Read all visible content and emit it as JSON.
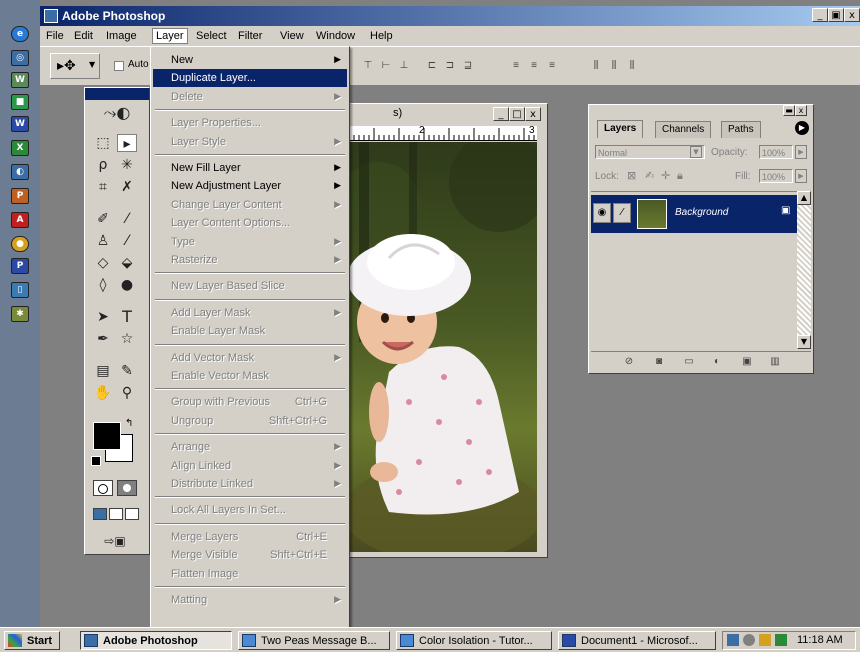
{
  "app": {
    "title": "Adobe Photoshop",
    "window_controls": [
      "_",
      "▣",
      "x"
    ]
  },
  "menubar": [
    "File",
    "Edit",
    "Image",
    "Layer",
    "Select",
    "Filter",
    "View",
    "Window",
    "Help"
  ],
  "options_bar": {
    "auto_select_label": "Auto"
  },
  "document": {
    "title_fragment": "s)",
    "ruler_marks": [
      "2",
      "3"
    ]
  },
  "layers_palette": {
    "tabs": [
      "Layers",
      "Channels",
      "Paths"
    ],
    "blend_mode": "Normal",
    "opacity_label": "Opacity:",
    "opacity_value": "100%",
    "lock_label": "Lock:",
    "fill_label": "Fill:",
    "fill_value": "100%",
    "layer_name": "Background"
  },
  "layer_menu": [
    {
      "label": "New",
      "submenu": true,
      "enabled": true
    },
    {
      "label": "Duplicate Layer...",
      "enabled": true,
      "highlighted": true
    },
    {
      "label": "Delete",
      "submenu": true,
      "enabled": false
    },
    {
      "sep": true
    },
    {
      "label": "Layer Properties...",
      "enabled": false
    },
    {
      "label": "Layer Style",
      "submenu": true,
      "enabled": false
    },
    {
      "sep": true
    },
    {
      "label": "New Fill Layer",
      "submenu": true,
      "enabled": true
    },
    {
      "label": "New Adjustment Layer",
      "submenu": true,
      "enabled": true
    },
    {
      "label": "Change Layer Content",
      "submenu": true,
      "enabled": false
    },
    {
      "label": "Layer Content Options...",
      "enabled": false
    },
    {
      "label": "Type",
      "submenu": true,
      "enabled": false
    },
    {
      "label": "Rasterize",
      "submenu": true,
      "enabled": false
    },
    {
      "sep": true
    },
    {
      "label": "New Layer Based Slice",
      "enabled": false
    },
    {
      "sep": true
    },
    {
      "label": "Add Layer Mask",
      "submenu": true,
      "enabled": false
    },
    {
      "label": "Enable Layer Mask",
      "enabled": false
    },
    {
      "sep": true
    },
    {
      "label": "Add Vector Mask",
      "submenu": true,
      "enabled": false
    },
    {
      "label": "Enable Vector Mask",
      "enabled": false
    },
    {
      "sep": true
    },
    {
      "label": "Group with Previous",
      "shortcut": "Ctrl+G",
      "enabled": false
    },
    {
      "label": "Ungroup",
      "shortcut": "Shft+Ctrl+G",
      "enabled": false
    },
    {
      "sep": true
    },
    {
      "label": "Arrange",
      "submenu": true,
      "enabled": false
    },
    {
      "label": "Align Linked",
      "submenu": true,
      "enabled": false
    },
    {
      "label": "Distribute Linked",
      "submenu": true,
      "enabled": false
    },
    {
      "sep": true
    },
    {
      "label": "Lock All Layers In Set...",
      "enabled": false
    },
    {
      "sep": true
    },
    {
      "label": "Merge Layers",
      "shortcut": "Ctrl+E",
      "enabled": false
    },
    {
      "label": "Merge Visible",
      "shortcut": "Shft+Ctrl+E",
      "enabled": false
    },
    {
      "label": "Flatten Image",
      "enabled": false
    },
    {
      "sep": true
    },
    {
      "label": "Matting",
      "submenu": true,
      "enabled": false
    }
  ],
  "taskbar": {
    "start_label": "Start",
    "tasks": [
      "Adobe Photoshop",
      "Two Peas Message B...",
      "Color Isolation - Tutor...",
      "Document1 - Microsof..."
    ],
    "clock": "11:18 AM"
  },
  "colors": {
    "title_blue": "#0a246a",
    "face": "#d4d0c8",
    "workspace": "#808080"
  }
}
